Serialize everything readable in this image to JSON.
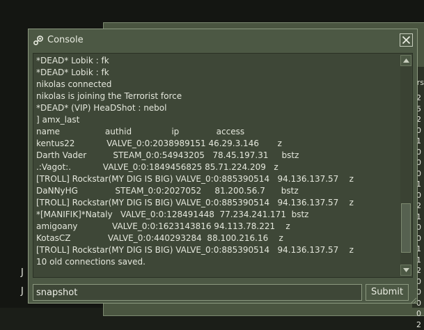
{
  "window": {
    "title": "Console",
    "close_icon": "close-icon",
    "title_icon": "steam-icon"
  },
  "log": {
    "lines": [
      "*DEAD* Lobik : fk",
      "*DEAD* Lobik : fk",
      "nikolas connected",
      "nikolas is joining the Terrorist force",
      "*DEAD* (VIP) HeaDShot : nebol",
      "] amx_last",
      "name                 authid               ip              access",
      "kentus22            VALVE_0:0:2038989151 46.29.3.146       z",
      "Darth Vader          STEAM_0:0:54943205   78.45.197.31     bstz",
      ".:Vagot:.            VALVE_0:0:1849456825 85.71.224.209   z",
      "[TROLL] Rockstar(MY DIG IS BIG) VALVE_0:0:885390514   94.136.137.57    z",
      "DaNNyHG              STEAM_0:0:2027052     81.200.56.7      bstz",
      "[TROLL] Rockstar(MY DIG IS BIG) VALVE_0:0:885390514   94.136.137.57    z",
      "*[MANIFIK]*Nataly   VALVE_0:0:128491448  77.234.241.171  bstz",
      "amigoany             VALVE_0:0:1623143816 94.113.78.221    z",
      "KotasCZ              VALVE_0:0:440293284  88.100.216.16    z",
      "[TROLL] Rockstar(MY DIG IS BIG) VALVE_0:0:885390514   94.136.137.57    z",
      "10 old connections saved."
    ],
    "scroll_position_fraction": 0.92,
    "visible_fraction": 0.25
  },
  "command": {
    "value": "snapshot"
  },
  "submit_label": "Submit",
  "background": {
    "column_header": "ers",
    "digits": [
      "2",
      "5",
      "2",
      "0",
      "1",
      "0",
      "0",
      "0",
      "1",
      "0",
      "2",
      "1",
      "0",
      "0",
      "1",
      "1",
      "2",
      "0",
      "0",
      "0",
      "0",
      "2"
    ],
    "left_fragment_1": "J",
    "left_fragment_2": "J"
  },
  "colors": {
    "window_bg": "#4c5844",
    "panel_bg": "#3e4737",
    "text": "#e4e7dc",
    "border": "#8c9980"
  }
}
